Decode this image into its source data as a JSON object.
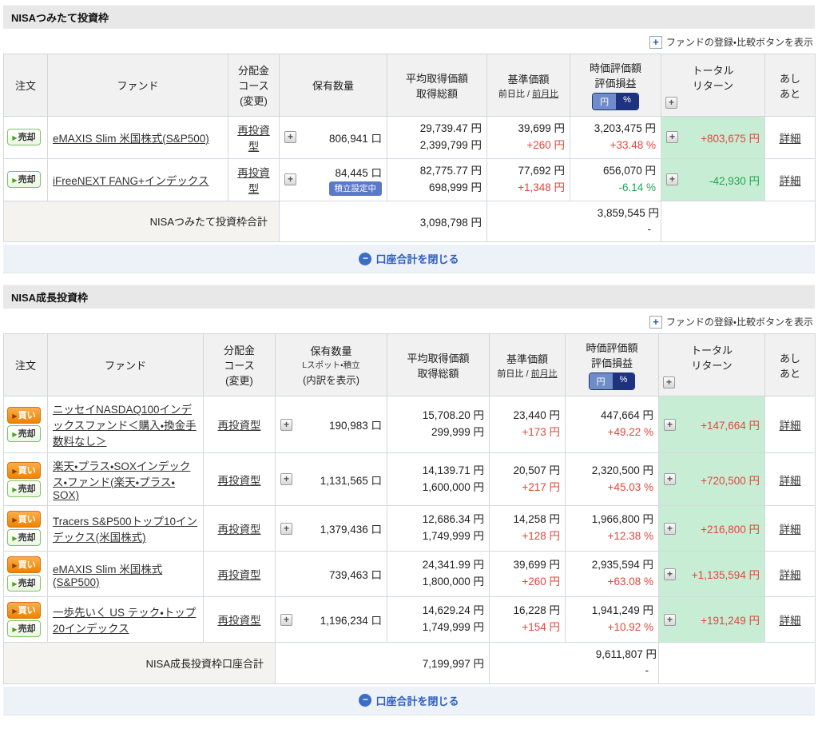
{
  "colors": {
    "positive_red": "#e0483c",
    "negative_green": "#23a454",
    "total_return_bg": "#c8edd5",
    "link_blue": "#2f5fc0",
    "toggle_yen_bg": "#6d8cc8",
    "toggle_pct_bg": "#1e3380",
    "badge_blue": "#5b79c9"
  },
  "table_header": {
    "order": "注文",
    "fund": "ファンド",
    "dist_line1": "分配金",
    "dist_line2": "コース",
    "dist_line3": "(変更)",
    "holdings": "保有数量",
    "avg_line1": "平均取得価額",
    "avg_line2": "取得総額",
    "nav": "基準価額",
    "nav_sub_prefix": "前日比 / ",
    "nav_sub_link": "前月比",
    "market_line1": "時価評価額",
    "market_line2": "評価損益",
    "toggle_yen": "円",
    "toggle_pct": "%",
    "total_line1": "トータル",
    "total_line2": "リターン",
    "footprint_line1": "あし",
    "footprint_line2": "あと",
    "expand_plus": "+"
  },
  "buttons": {
    "buy": "買い",
    "sell": "売却",
    "detail": "詳細",
    "arrow": "▶"
  },
  "register_compare_label": "ファンドの登録・比較ボタンを表示",
  "register_compare_plus": "+",
  "close_account_total_label": "口座合計を閉じる",
  "close_minus": "−",
  "sections": [
    {
      "title": "NISAつみたて投資枠",
      "holdings_sub1": "",
      "holdings_sub2": "",
      "rows": [
        {
          "buy": false,
          "fund": "eMAXIS Slim 米国株式(S&P500)",
          "dist": "再投資型",
          "holdings_plus": true,
          "holdings": "806,941 口",
          "badge": false,
          "badge_label": "",
          "avg_price": "29,739.47 円",
          "acq_total": "2,399,799 円",
          "nav": "39,699 円",
          "nav_change": "+260 円",
          "nav_change_dir": "up",
          "market_value": "3,203,475 円",
          "pl_percent": "+33.48 %",
          "pl_dir": "up",
          "total_return": "+803,675 円",
          "total_return_dir": "up"
        },
        {
          "buy": false,
          "fund": "iFreeNEXT FANG+インデックス",
          "dist": "再投資型",
          "holdings_plus": true,
          "holdings": "84,445 口",
          "badge": true,
          "badge_label": "積立設定中",
          "avg_price": "82,775.77 円",
          "acq_total": "698,999 円",
          "nav": "77,692 円",
          "nav_change": "+1,348 円",
          "nav_change_dir": "up",
          "market_value": "656,070 円",
          "pl_percent": "-6.14 %",
          "pl_dir": "down",
          "total_return": "-42,930 円",
          "total_return_dir": "down"
        }
      ],
      "subtotal": {
        "label": "NISAつみたて投資枠合計",
        "acq_total": "3,098,798 円",
        "market_total": "3,859,545 円",
        "dash": "-"
      }
    },
    {
      "title": "NISA成長投資枠",
      "holdings_sub1": "Lスポット・積立",
      "holdings_sub2": "(内訳を表示)",
      "rows": [
        {
          "buy": true,
          "fund": "ニッセイNASDAQ100インデックスファンド＜購入・換金手数料なし＞",
          "dist": "再投資型",
          "holdings_plus": true,
          "holdings": "190,983 口",
          "badge": false,
          "badge_label": "",
          "avg_price": "15,708.20 円",
          "acq_total": "299,999 円",
          "nav": "23,440 円",
          "nav_change": "+173 円",
          "nav_change_dir": "up",
          "market_value": "447,664 円",
          "pl_percent": "+49.22 %",
          "pl_dir": "up",
          "total_return": "+147,664 円",
          "total_return_dir": "up"
        },
        {
          "buy": true,
          "fund": "楽天・プラス・SOXインデックス・ファンド(楽天・プラス・SOX)",
          "dist": "再投資型",
          "holdings_plus": true,
          "holdings": "1,131,565 口",
          "badge": false,
          "badge_label": "",
          "avg_price": "14,139.71 円",
          "acq_total": "1,600,000 円",
          "nav": "20,507 円",
          "nav_change": "+217 円",
          "nav_change_dir": "up",
          "market_value": "2,320,500 円",
          "pl_percent": "+45.03 %",
          "pl_dir": "up",
          "total_return": "+720,500 円",
          "total_return_dir": "up"
        },
        {
          "buy": true,
          "fund": "Tracers S&P500トップ10インデックス(米国株式)",
          "dist": "再投資型",
          "holdings_plus": true,
          "holdings": "1,379,436 口",
          "badge": false,
          "badge_label": "",
          "avg_price": "12,686.34 円",
          "acq_total": "1,749,999 円",
          "nav": "14,258 円",
          "nav_change": "+128 円",
          "nav_change_dir": "up",
          "market_value": "1,966,800 円",
          "pl_percent": "+12.38 %",
          "pl_dir": "up",
          "total_return": "+216,800 円",
          "total_return_dir": "up"
        },
        {
          "buy": true,
          "fund": "eMAXIS Slim 米国株式(S&P500)",
          "dist": "再投資型",
          "holdings_plus": false,
          "holdings": "739,463 口",
          "badge": false,
          "badge_label": "",
          "avg_price": "24,341.99 円",
          "acq_total": "1,800,000 円",
          "nav": "39,699 円",
          "nav_change": "+260 円",
          "nav_change_dir": "up",
          "market_value": "2,935,594 円",
          "pl_percent": "+63.08 %",
          "pl_dir": "up",
          "total_return": "+1,135,594 円",
          "total_return_dir": "up"
        },
        {
          "buy": true,
          "fund": "一歩先いく US テック・トップ20インデックス",
          "dist": "再投資型",
          "holdings_plus": true,
          "holdings": "1,196,234 口",
          "badge": false,
          "badge_label": "",
          "avg_price": "14,629.24 円",
          "acq_total": "1,749,999 円",
          "nav": "16,228 円",
          "nav_change": "+154 円",
          "nav_change_dir": "up",
          "market_value": "1,941,249 円",
          "pl_percent": "+10.92 %",
          "pl_dir": "up",
          "total_return": "+191,249 円",
          "total_return_dir": "up"
        }
      ],
      "subtotal": {
        "label": "NISA成長投資枠口座合計",
        "acq_total": "7,199,997 円",
        "market_total": "9,611,807 円",
        "dash": "-"
      }
    }
  ]
}
